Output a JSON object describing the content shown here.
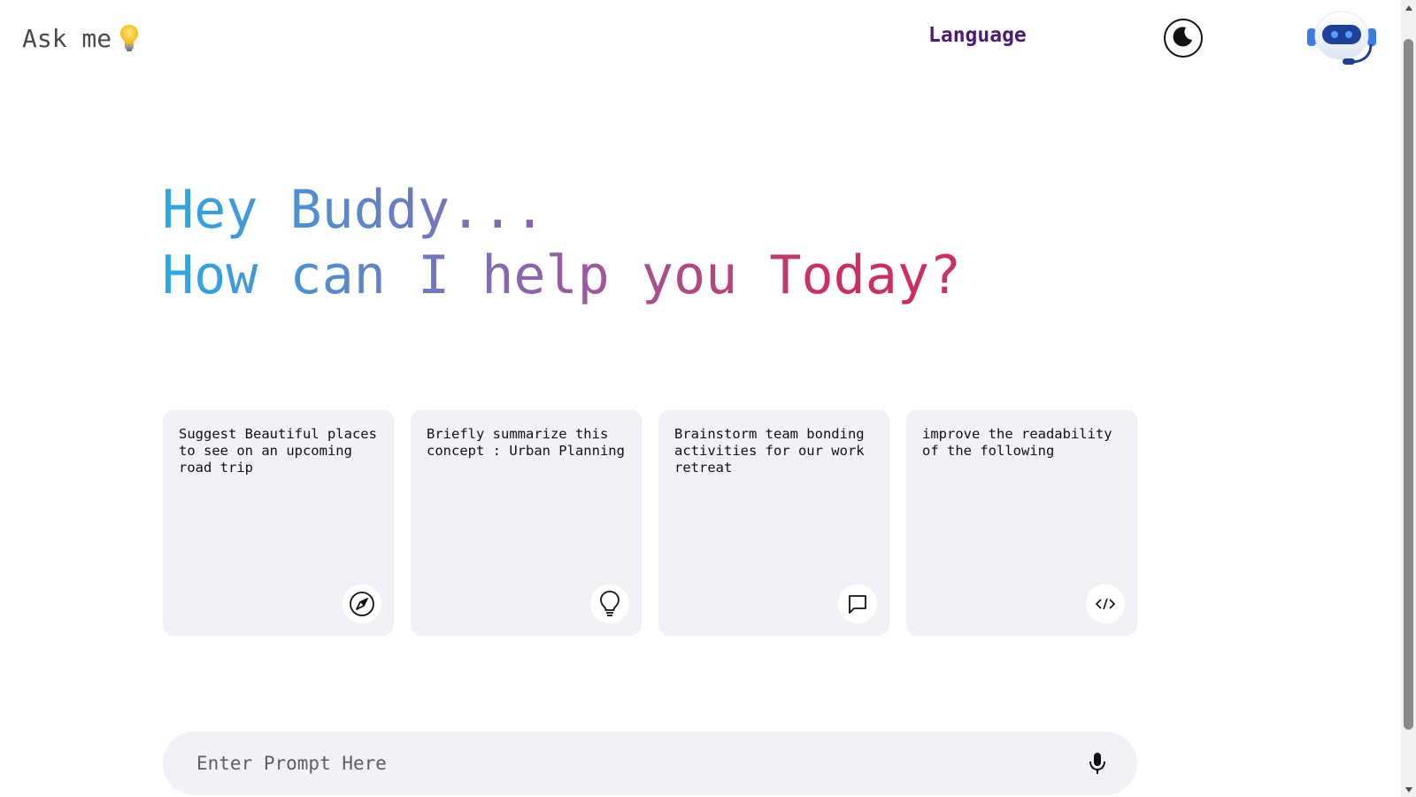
{
  "header": {
    "brand_label": "Ask me",
    "brand_icon": "lightbulb-icon",
    "language_label": "Language",
    "theme_icon": "moon-icon",
    "avatar_icon": "robot-avatar-icon"
  },
  "greeting": {
    "line1": "Hey Buddy...",
    "line2": "How can I help you Today?",
    "gradient_colors": [
      "#2aa8e6",
      "#8a66ae",
      "#cc2f5e"
    ]
  },
  "cards": [
    {
      "text": "Suggest Beautiful places to see on an upcoming road trip",
      "icon": "compass-icon"
    },
    {
      "text": "Briefly summarize this concept : Urban Planning",
      "icon": "lightbulb-icon"
    },
    {
      "text": "Brainstorm team bonding activities for our work retreat",
      "icon": "message-icon"
    },
    {
      "text": "improve the readability of the following",
      "icon": "code-icon"
    }
  ],
  "prompt": {
    "placeholder": "Enter Prompt Here",
    "value": "",
    "mic_icon": "microphone-icon"
  },
  "colors": {
    "card_bg": "#f0f2f7",
    "language_color": "#4b1b7a",
    "brand_color": "#4a4a4a"
  }
}
